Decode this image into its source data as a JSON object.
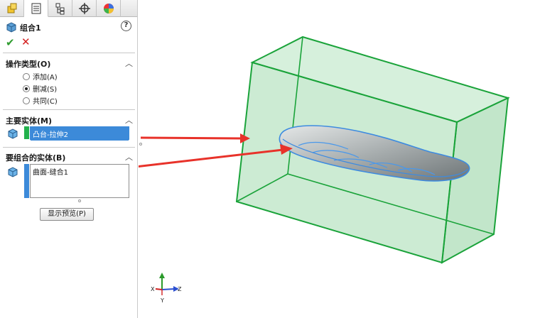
{
  "feature": {
    "title": "组合1",
    "help_icon": "help-icon",
    "help_label": "?",
    "ok_label": "✔",
    "cancel_label": "✕"
  },
  "tabs": [
    "feature-manager-icon",
    "property-manager-icon",
    "configuration-manager-icon",
    "dimxpert-icon",
    "display-manager-icon"
  ],
  "operation_type": {
    "title": "操作类型(O)",
    "options": [
      {
        "label": "添加(A)",
        "selected": false
      },
      {
        "label": "删减(S)",
        "selected": true
      },
      {
        "label": "共同(C)",
        "selected": false
      }
    ]
  },
  "main_body": {
    "title": "主要实体(M)",
    "item": "凸台-拉伸2",
    "accent": "#22b14c"
  },
  "combine_bodies": {
    "title": "要组合的实体(B)",
    "item": "曲面-缝合1",
    "accent": "#3c8ad9"
  },
  "preview_button": "显示预览(P)",
  "triad": {
    "x": "X",
    "y": "Y",
    "z": "Z"
  },
  "colors": {
    "box_edge": "#1aa33a",
    "box_fill": "#9ad8a8",
    "arrow": "#e8322a",
    "selection": "#3c8ad9"
  }
}
